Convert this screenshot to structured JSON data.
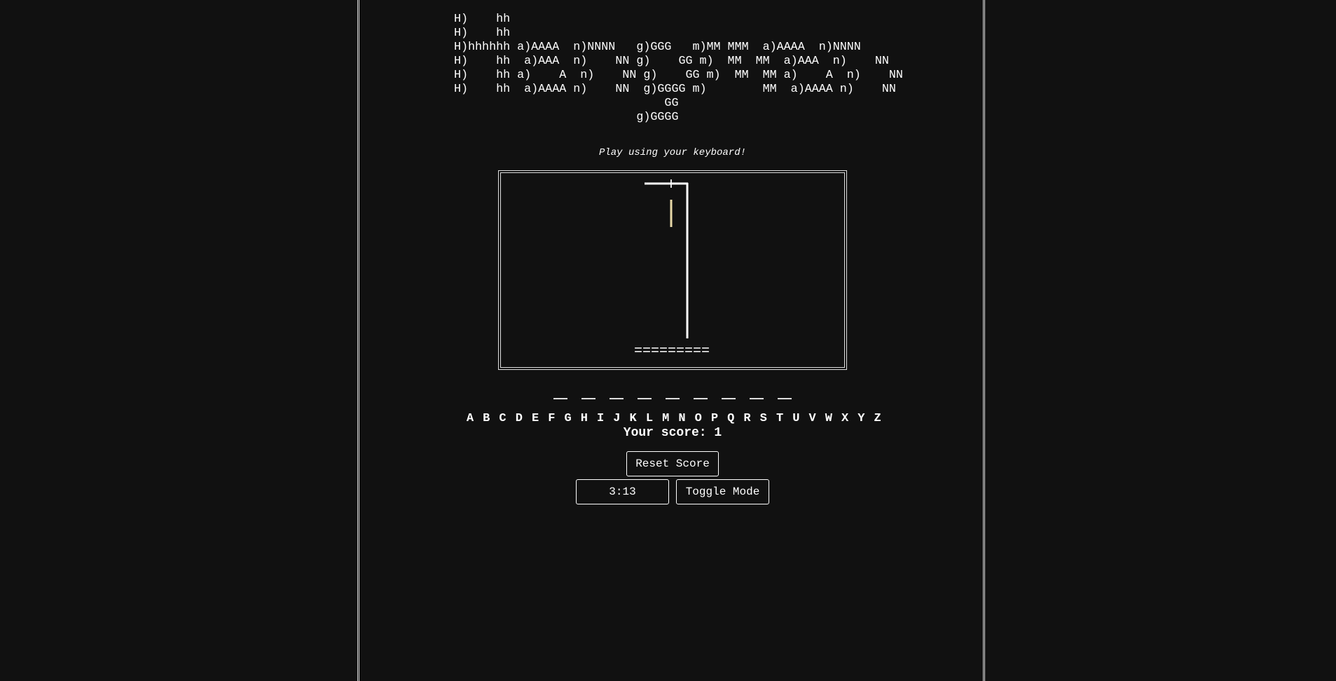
{
  "game": {
    "logo_lines": [
      "H)    hh",
      "H)    hh",
      "H)hhhhhh a)AAAA  n)NNNN   g)GGG   m)MM MMM  a)AAAA  n)NNNN",
      "H)    hh  a)AAA  n)    NN g)    GG m)  MM  MM  a)AAA  n)    NN",
      "H)    hh a)    A  n)    NN g)    GG m)  MM  MM a)    A  n)    NN",
      "H)    hh  a)AAAA n)    NN  g)GGGG m)        MM  a)AAAA n)    NN",
      "                              GG",
      "                          g)GGGG"
    ],
    "instruction": "Play using your keyboard!",
    "word_slots": [
      "",
      "",
      "",
      "",
      "",
      "",
      "",
      "",
      ""
    ],
    "gallows": {
      "hook_glyph": "+",
      "floor": "=========",
      "line_color": "#ffffff",
      "accent_color": "#e8d9a8"
    },
    "alphabet": [
      "A",
      "B",
      "C",
      "D",
      "E",
      "F",
      "G",
      "H",
      "I",
      "J",
      "K",
      "L",
      "M",
      "N",
      "O",
      "P",
      "Q",
      "R",
      "S",
      "T",
      "U",
      "V",
      "W",
      "X",
      "Y",
      "Z"
    ],
    "score_text": "Your score: 1",
    "reset_label": "Reset Score",
    "timer": "3:13",
    "toggle_label": "Toggle Mode"
  },
  "colors": {
    "background": "#111111",
    "text": "#ffffff",
    "border": "#dddddd"
  }
}
